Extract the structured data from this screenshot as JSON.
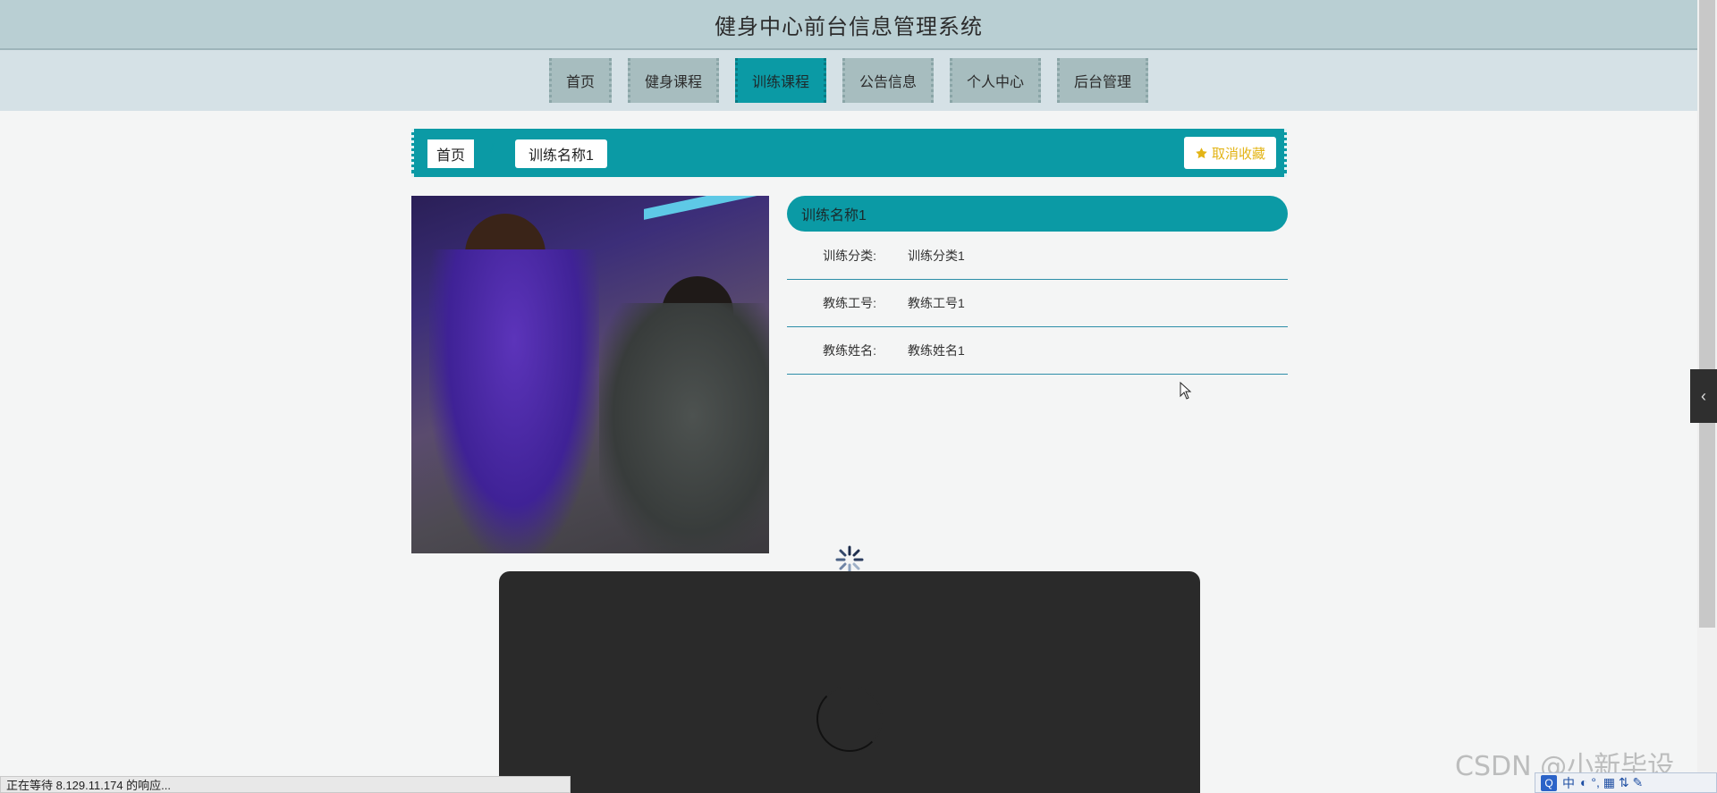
{
  "header": {
    "title": "健身中心前台信息管理系统"
  },
  "nav": {
    "items": [
      {
        "label": "首页"
      },
      {
        "label": "健身课程"
      },
      {
        "label": "训练课程",
        "active": true
      },
      {
        "label": "公告信息"
      },
      {
        "label": "个人中心"
      },
      {
        "label": "后台管理"
      }
    ]
  },
  "breadcrumb": {
    "home": "首页",
    "separator": "/",
    "current": "训练名称1"
  },
  "favorite": {
    "label": "取消收藏",
    "icon": "star-icon"
  },
  "detail": {
    "title": "训练名称1",
    "fields": [
      {
        "label": "训练分类:",
        "value": "训练分类1"
      },
      {
        "label": "教练工号:",
        "value": "教练工号1"
      },
      {
        "label": "教练姓名:",
        "value": "教练姓名1"
      }
    ]
  },
  "status": {
    "text": "正在等待 8.129.11.174 的响应..."
  },
  "watermark": {
    "text": "CSDN @小新毕设"
  },
  "ime": {
    "q": "Q",
    "mode": "中",
    "extra": "◐ °, ▦ ⇅ ✎"
  },
  "side_tab": {
    "icon": "chevron-left-icon",
    "glyph": "‹"
  },
  "colors": {
    "accent": "#0b9aa5",
    "header": "#b9cfd3",
    "nav_item": "#a7bdbf",
    "favorite": "#e3b416"
  }
}
